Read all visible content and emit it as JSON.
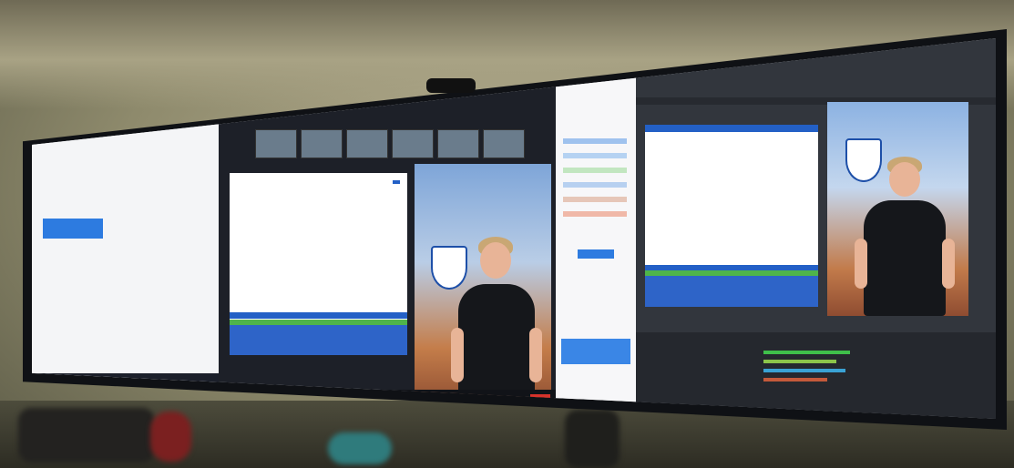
{
  "scene": {
    "description_free": true,
    "colors": {
      "wall": "#a8a284",
      "desk": "#2d2c23",
      "bezel": "#0f1115",
      "accent_blue": "#2d7be0",
      "slide_blue": "#2360c6",
      "slide_green": "#4fb44a",
      "leave_red": "#d6332b",
      "obs_dark": "#32363d"
    },
    "icons": [
      "webcam-icon",
      "crest-icon"
    ]
  }
}
